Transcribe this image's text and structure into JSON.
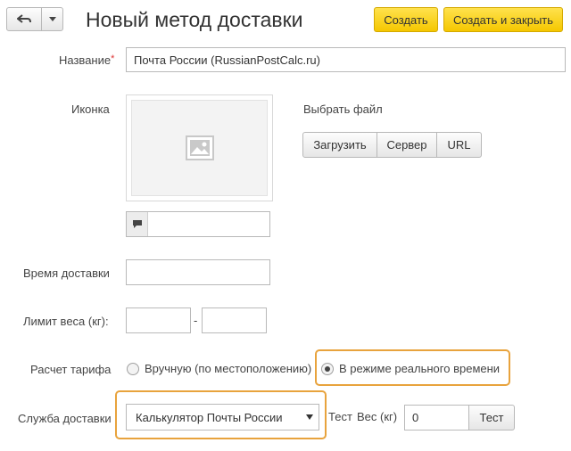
{
  "header": {
    "title": "Новый метод доставки",
    "create_label": "Создать",
    "create_close_label": "Создать и закрыть"
  },
  "form": {
    "name": {
      "label": "Название",
      "required_mark": "*",
      "value": "Почта России (RussianPostCalc.ru)"
    },
    "icon": {
      "label": "Иконка",
      "choose_file": "Выбрать файл",
      "buttons": {
        "upload": "Загрузить",
        "server": "Сервер",
        "url": "URL"
      }
    },
    "delivery_time": {
      "label": "Время доставки",
      "value": ""
    },
    "weight_limit": {
      "label": "Лимит веса (кг):",
      "from": "",
      "separator": "-",
      "to": ""
    },
    "tariff": {
      "label": "Расчет тарифа",
      "options": [
        "Вручную (по местоположению)",
        "В режиме реального времени"
      ],
      "selected": "В режиме реального времени"
    },
    "service": {
      "label": "Служба доставки",
      "selected": "Калькулятор Почты России",
      "test_label": "Тест",
      "weight_label": "Вес (кг)",
      "weight_value": "0",
      "test_button": "Тест"
    }
  },
  "colors": {
    "accent_yellow": "#f5c700",
    "highlight": "#e8a33d"
  }
}
